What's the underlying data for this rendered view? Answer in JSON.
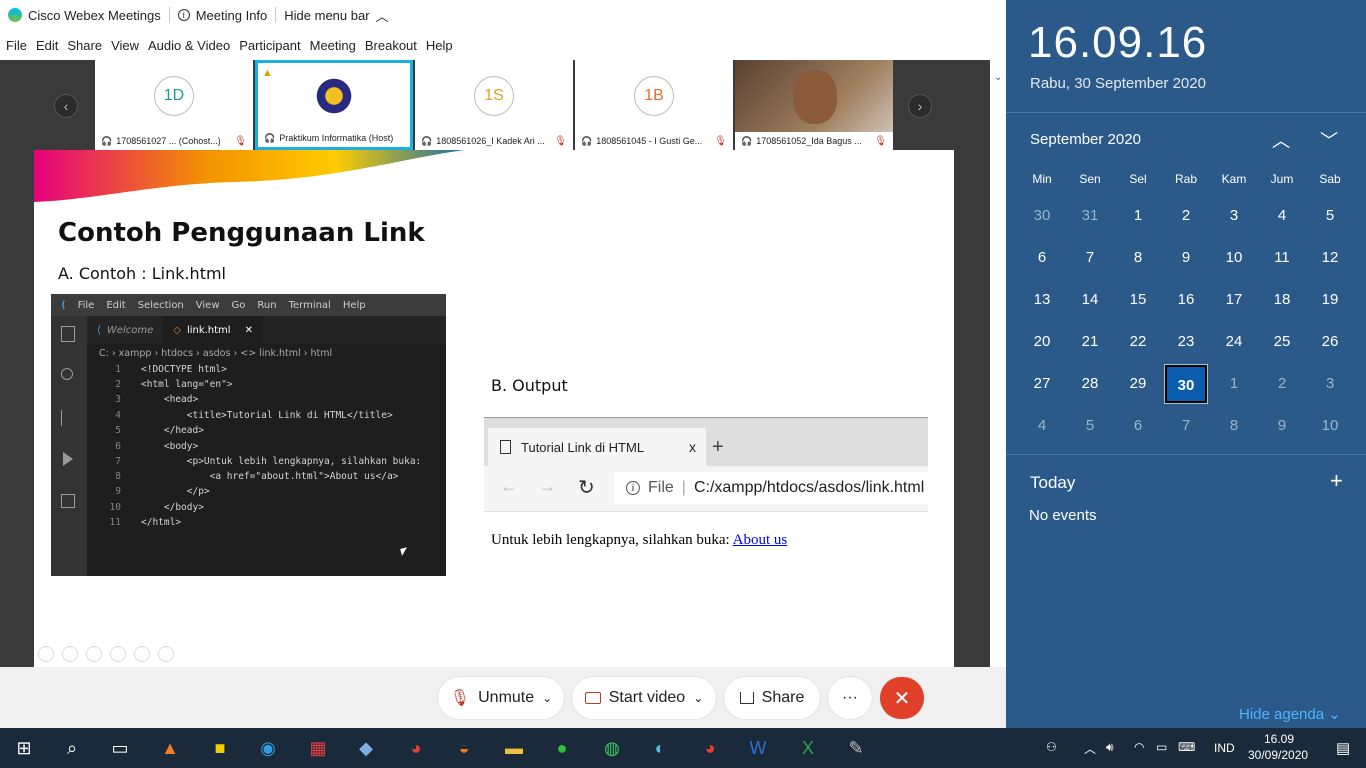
{
  "titlebar": {
    "app_title": "Cisco Webex Meetings",
    "meeting_info": "Meeting Info",
    "hide_menu": "Hide menu bar"
  },
  "menu": [
    "File",
    "Edit",
    "Share",
    "View",
    "Audio & Video",
    "Participant",
    "Meeting",
    "Breakout",
    "Help"
  ],
  "participants": [
    {
      "initials": "1D",
      "name": "1708561027 ... (Cohost...)",
      "color": "#1e9c8a"
    },
    {
      "initials": "",
      "name": "Praktikum Informatika (Host)",
      "color": "#333"
    },
    {
      "initials": "1S",
      "name": "1808561026_I Kadek Ari ...",
      "color": "#e0a020"
    },
    {
      "initials": "1B",
      "name": "1808561045 - I Gusti Ge...",
      "color": "#e07030"
    },
    {
      "initials": "",
      "name": "1708561052_Ida Bagus ...",
      "color": "#333"
    }
  ],
  "slide": {
    "title": "Contoh Penggunaan Link",
    "subtitle": "A. Contoh : Link.html",
    "output_label": "B. Output"
  },
  "vscode": {
    "menu": [
      "File",
      "Edit",
      "Selection",
      "View",
      "Go",
      "Run",
      "Terminal",
      "Help"
    ],
    "tab_welcome": "Welcome",
    "tab_file": "link.html",
    "breadcrumb": "C: › xampp › htdocs › asdos › <> link.html › html",
    "line_numbers": [
      "1",
      "2",
      "3",
      "4",
      "5",
      "6",
      "7",
      "8",
      "9",
      "10",
      "11"
    ],
    "lines": [
      "<!DOCTYPE html>",
      "<html lang=\"en\">",
      "    <head>",
      "        <title>Tutorial Link di HTML</title>",
      "    </head>",
      "    <body>",
      "        <p>Untuk lebih lengkapnya, silahkan buka:",
      "            <a href=\"about.html\">About us</a>",
      "        </p>",
      "    </body>",
      "</html>"
    ]
  },
  "browser": {
    "tab_title": "Tutorial Link di HTML",
    "tab_close": "x",
    "new_tab": "+",
    "file_label": "File",
    "url": "C:/xampp/htdocs/asdos/link.html",
    "content_text": "Untuk lebih lengkapnya, silahkan buka:",
    "link_text": "About us"
  },
  "controls": {
    "unmute": "Unmute",
    "start_video": "Start video",
    "share": "Share",
    "more": "···"
  },
  "calendar": {
    "clock": "16.09.16",
    "date_full": "Rabu, 30 September 2020",
    "month_label": "September 2020",
    "day_headers": [
      "Min",
      "Sen",
      "Sel",
      "Rab",
      "Kam",
      "Jum",
      "Sab"
    ],
    "weeks": [
      [
        "30",
        "31",
        "1",
        "2",
        "3",
        "4",
        "5"
      ],
      [
        "6",
        "7",
        "8",
        "9",
        "10",
        "11",
        "12"
      ],
      [
        "13",
        "14",
        "15",
        "16",
        "17",
        "18",
        "19"
      ],
      [
        "20",
        "21",
        "22",
        "23",
        "24",
        "25",
        "26"
      ],
      [
        "27",
        "28",
        "29",
        "30",
        "1",
        "2",
        "3"
      ],
      [
        "4",
        "5",
        "6",
        "7",
        "8",
        "9",
        "10"
      ]
    ],
    "today_label": "Today",
    "no_events": "No events",
    "hide_agenda": "Hide agenda"
  },
  "tray": {
    "lang": "IND",
    "time": "16.09",
    "date": "30/09/2020"
  }
}
